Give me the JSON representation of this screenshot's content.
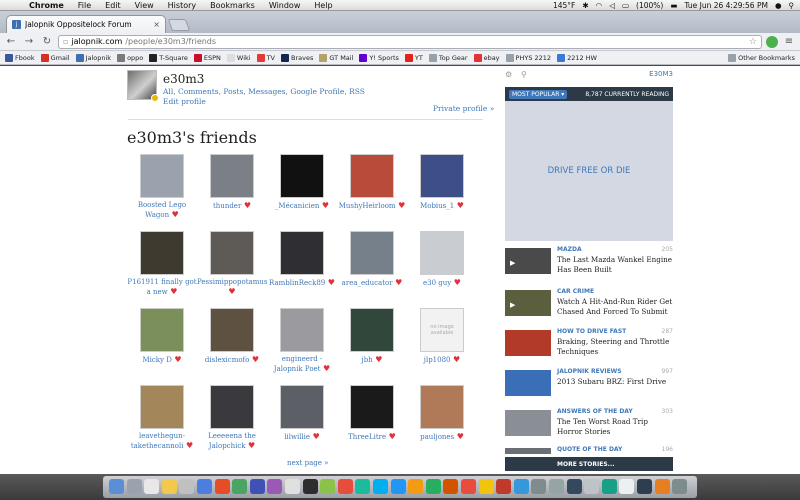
{
  "menubar": {
    "apple": "",
    "items": [
      "Chrome",
      "File",
      "Edit",
      "View",
      "History",
      "Bookmarks",
      "Window",
      "Help"
    ],
    "temperature": "145°F",
    "battery": "(100%)",
    "clock": "Tue Jun 26  4:29:56 PM"
  },
  "tab": {
    "title": "Jalopnik Oppositelock Forum",
    "close": "×"
  },
  "omnibox": {
    "host": "jalopnik.com",
    "path": "/people/e30m3/friends"
  },
  "bookmarks": [
    "Fbook",
    "Gmail",
    "Jalopnik",
    "oppo",
    "T-Square",
    "ESPN",
    "Wiki",
    "TV",
    "Braves",
    "GT Mail",
    "Y! Sports",
    "YT",
    "Top Gear",
    "ebay",
    "PHYS 2212",
    "2212 HW"
  ],
  "bookmarks_other": "Other Bookmarks",
  "profile": {
    "username": "e30m3",
    "links": [
      "All",
      "Comments",
      "Posts",
      "Messages",
      "Google Profile",
      "RSS"
    ],
    "edit": "Edit profile",
    "private": "Private profile »"
  },
  "friends_heading": "e30m3's friends",
  "friends": [
    {
      "name": "Boosted Lego Wagon",
      "color": "#9aa3ad"
    },
    {
      "name": "thunder",
      "color": "#7b7f86"
    },
    {
      "name": "_Mécanicien",
      "color": "#111111"
    },
    {
      "name": "MushyHeirloom",
      "color": "#b84b3a"
    },
    {
      "name": "Mobius_1",
      "color": "#3d4f86"
    },
    {
      "name": "P161911 finally got a new",
      "color": "#3f3a2f"
    },
    {
      "name": "Pessimippopotamus",
      "color": "#5e5a55"
    },
    {
      "name": "RamblinReck89",
      "color": "#2f2f33"
    },
    {
      "name": "area_educator",
      "color": "#76808a"
    },
    {
      "name": "e30 guy",
      "color": "#c9ccd1"
    },
    {
      "name": "Micky D",
      "color": "#7a8f5a"
    },
    {
      "name": "dislexicmofo",
      "color": "#5f5142"
    },
    {
      "name": "engineerd - Jalopnik Poet",
      "color": "#9b9b9f"
    },
    {
      "name": "jbh",
      "color": "#31473b"
    },
    {
      "name": "jlp1080",
      "color": "#f2f2f2"
    },
    {
      "name": "leavethegun-takethecannoli",
      "color": "#a3865a"
    },
    {
      "name": "Leeeeena the Jalopchick",
      "color": "#3a3a3e"
    },
    {
      "name": "lilwillie",
      "color": "#5c5f66"
    },
    {
      "name": "ThreeLitre",
      "color": "#1a1a1a"
    },
    {
      "name": "pauljones",
      "color": "#b07a58"
    }
  ],
  "no_image": "no image available",
  "next_page": "next page »",
  "sidebar": {
    "site": "E30M3",
    "popular": "MOST POPULAR ▾",
    "reading": "8,787 CURRENTLY READING",
    "ad": "DRIVE FREE OR DIE",
    "stories": [
      {
        "cat": "MAZDA",
        "count": "205",
        "headline": "The Last Mazda Wankel Engine Has Been Built",
        "color": "#4a4a4a"
      },
      {
        "cat": "CAR CRIME",
        "count": "",
        "headline": "Watch A Hit-And-Run Rider Get Chased And Forced To Submit",
        "color": "#5b5f3d"
      },
      {
        "cat": "HOW TO DRIVE FAST",
        "count": "287",
        "headline": "Braking, Steering and Throttle Techniques",
        "color": "#b23a28"
      },
      {
        "cat": "JALOPNIK REVIEWS",
        "count": "997",
        "headline": "2013 Subaru BRZ: First Drive",
        "color": "#3a6fb8"
      },
      {
        "cat": "ANSWERS OF THE DAY",
        "count": "303",
        "headline": "The Ten Worst Road Trip Horror Stories",
        "color": "#8a8f96"
      },
      {
        "cat": "QUOTE OF THE DAY",
        "count": "196",
        "headline": "",
        "color": "#6a6f75"
      }
    ],
    "more": "MORE STORIES..."
  }
}
